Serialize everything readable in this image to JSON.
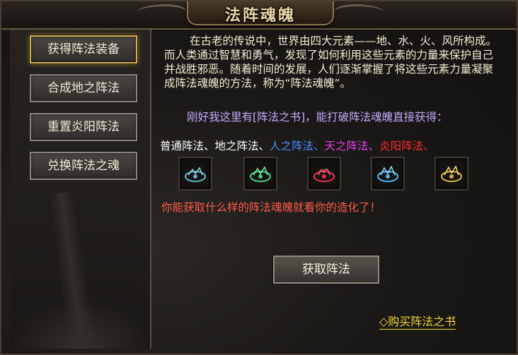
{
  "window": {
    "title": "法阵魂魄"
  },
  "menu": {
    "items": [
      {
        "label": "获得阵法装备",
        "active": true
      },
      {
        "label": "合成地之阵法",
        "active": false
      },
      {
        "label": "重置炎阳阵法",
        "active": false
      },
      {
        "label": "兑换阵法之魂",
        "active": false
      }
    ]
  },
  "content": {
    "description": "在古老的传说中，世界由四大元素——地、水、火、风所构成。而人类通过智慧和勇气，发现了如何利用这些元素的力量来保护自己并战胜邪恶。随着时间的发展，人们逐渐掌握了将这些元素力量凝聚成阵法魂魄的方法，称为“阵法魂魄”。",
    "hint": "刚好我这里有[阵法之书]，能打破阵法魂魄直接获得：",
    "formation_types": [
      {
        "text": "普通阵法、",
        "color": "#ffffff"
      },
      {
        "text": "地之阵法、",
        "color": "#ffffff"
      },
      {
        "text": "人之阵法、",
        "color": "#4a8cff"
      },
      {
        "text": "天之阵法、",
        "color": "#e040e8"
      },
      {
        "text": "炎阳阵法、",
        "color": "#ff2a2a"
      }
    ],
    "slots": [
      {
        "icon": "ice-formation-icon",
        "color": "#5fb0c8"
      },
      {
        "icon": "jade-formation-icon",
        "color": "#3fd07a"
      },
      {
        "icon": "flame-formation-icon",
        "color": "#e8304a"
      },
      {
        "icon": "water-formation-icon",
        "color": "#4ab8f0"
      },
      {
        "icon": "gold-formation-icon",
        "color": "#d8b040"
      }
    ],
    "warning": "你能获取什么样的阵法魂魄就看你的造化了！",
    "obtain_button": "获取阵法",
    "buy_link": "◇购买阵法之书"
  }
}
